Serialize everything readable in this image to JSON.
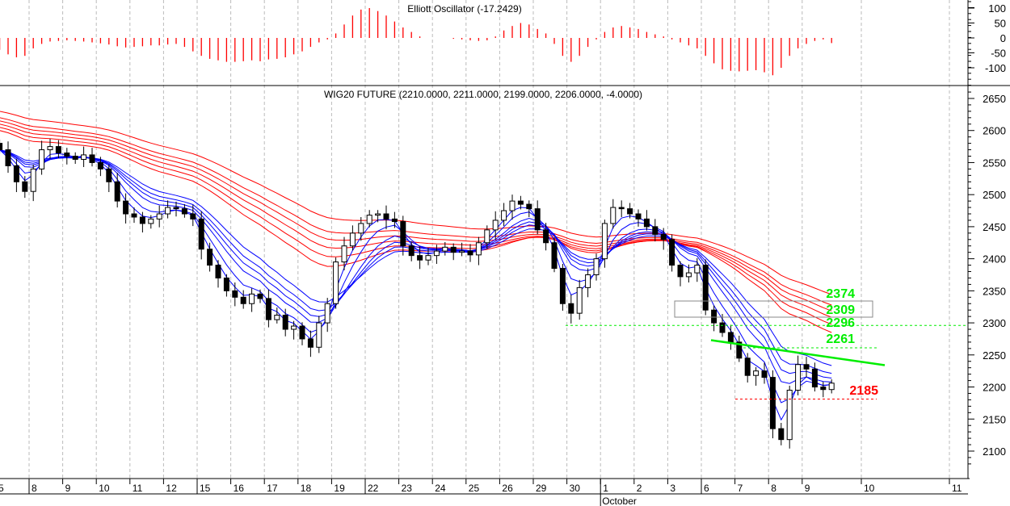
{
  "chart_data": {
    "type": "candlestick",
    "panels": [
      {
        "name": "oscillator",
        "title": "Elliott Oscillator (-17.2429)",
        "yticks": [
          "100",
          "50",
          "0",
          "-50",
          "-100"
        ],
        "ylim": [
          -130,
          130
        ]
      },
      {
        "name": "price",
        "title": "WIG20 FUTURE (2210.0000, 2211.0000, 2199.0000, 2206.0000, -4.0000)",
        "yticks": [
          "2650",
          "2600",
          "2550",
          "2500",
          "2450",
          "2400",
          "2350",
          "2300",
          "2250",
          "2200",
          "2150",
          "2100"
        ],
        "ylim": [
          2070,
          2665
        ]
      }
    ],
    "x_labels": [
      "5",
      "8",
      "9",
      "10",
      "11",
      "12",
      "15",
      "16",
      "17",
      "18",
      "19",
      "22",
      "23",
      "24",
      "25",
      "26",
      "29",
      "30",
      "1",
      "2",
      "3",
      "6",
      "7",
      "8",
      "9",
      "10",
      "11"
    ],
    "month_label": "October",
    "points_per_day": 4,
    "close": [
      2570,
      2545,
      2520,
      2505,
      2540,
      2570,
      2575,
      2565,
      2560,
      2555,
      2562,
      2550,
      2540,
      2520,
      2490,
      2470,
      2465,
      2455,
      2462,
      2470,
      2480,
      2478,
      2470,
      2462,
      2415,
      2390,
      2370,
      2350,
      2340,
      2330,
      2345,
      2338,
      2305,
      2312,
      2290,
      2295,
      2275,
      2262,
      2300,
      2330,
      2395,
      2420,
      2440,
      2455,
      2468,
      2470,
      2462,
      2458,
      2420,
      2405,
      2398,
      2405,
      2412,
      2418,
      2410,
      2412,
      2406,
      2425,
      2445,
      2460,
      2475,
      2490,
      2485,
      2478,
      2445,
      2425,
      2385,
      2330,
      2315,
      2355,
      2375,
      2400,
      2455,
      2480,
      2478,
      2470,
      2462,
      2450,
      2438,
      2430,
      2390,
      2372,
      2378,
      2390,
      2320,
      2300,
      2285,
      2270,
      2245,
      2218,
      2225,
      2215,
      2135,
      2118,
      2195,
      2235,
      2228,
      2200,
      2196,
      2206
    ],
    "oscillator": [
      -40,
      -55,
      -65,
      -60,
      -35,
      -20,
      -12,
      -10,
      -8,
      -10,
      -12,
      -15,
      -18,
      -22,
      -28,
      -32,
      -30,
      -28,
      -25,
      -25,
      -22,
      -20,
      -30,
      -45,
      -60,
      -70,
      -75,
      -80,
      -80,
      -78,
      -75,
      -78,
      -72,
      -70,
      -65,
      -55,
      -45,
      -30,
      -15,
      -5,
      15,
      45,
      75,
      95,
      100,
      90,
      75,
      55,
      35,
      20,
      5,
      0,
      0,
      0,
      -3,
      -5,
      -8,
      -10,
      -8,
      5,
      25,
      40,
      50,
      45,
      30,
      15,
      -20,
      -60,
      -80,
      -60,
      -30,
      -5,
      20,
      35,
      40,
      35,
      30,
      20,
      12,
      5,
      -5,
      -15,
      -25,
      -35,
      -60,
      -85,
      -105,
      -110,
      -112,
      -110,
      -108,
      -115,
      -125,
      -100,
      -60,
      -35,
      -20,
      -10,
      -5,
      -17.2429
    ],
    "ma_fast_periods": [
      3,
      5,
      8,
      10,
      12,
      15
    ],
    "ma_slow_periods": [
      30,
      35,
      40,
      45,
      50,
      60
    ],
    "levels": [
      {
        "label": "2374",
        "value": 2374,
        "color": "#00ee00"
      },
      {
        "label": "2309",
        "value": 2309,
        "color": "#00ee00"
      },
      {
        "label": "2296",
        "value": 2296,
        "color": "#00ee00"
      },
      {
        "label": "2261",
        "value": 2261,
        "color": "#00ee00"
      },
      {
        "label": "2185",
        "value": 2185,
        "color": "#ff0000"
      }
    ],
    "trendline": {
      "from": [
        2273
      ],
      "to": [
        2234
      ],
      "color": "#00ee00"
    },
    "colors": {
      "fast": "#0000ff",
      "slow": "#ff0000",
      "osc": "#ff0000",
      "grid": "#bbbbbb"
    }
  }
}
